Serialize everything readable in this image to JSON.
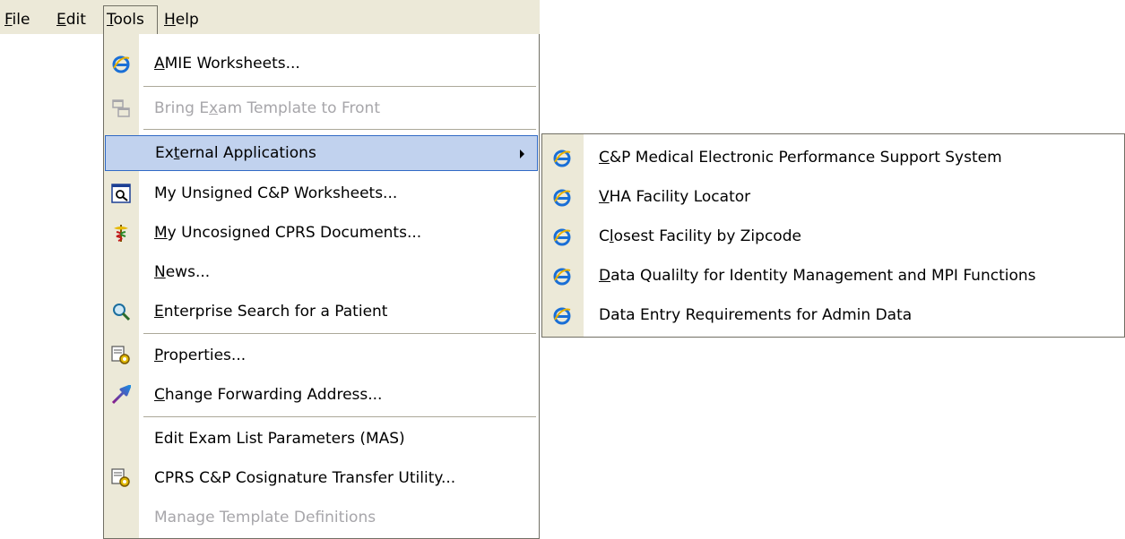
{
  "menubar": {
    "items": [
      {
        "pre": "",
        "ul": "F",
        "post": "ile"
      },
      {
        "pre": "",
        "ul": "E",
        "post": "dit"
      },
      {
        "pre": "",
        "ul": "T",
        "post": "ools"
      },
      {
        "pre": "",
        "ul": "H",
        "post": "elp"
      }
    ]
  },
  "tools_menu": {
    "items": [
      {
        "pre": "",
        "ul": "A",
        "post": "MIE Worksheets...",
        "icon": "ie-icon",
        "state": "enabled"
      },
      {
        "pre": "Bring E",
        "ul": "x",
        "post": "am Template to Front",
        "icon": "window-tile-icon",
        "state": "disabled"
      },
      {
        "pre": "Ex",
        "ul": "t",
        "post": "ernal Applications",
        "icon": "",
        "state": "highlighted",
        "submenu_arrow": "▶"
      },
      {
        "pre": "My Unsigned C&P Worksheets...",
        "ul": "",
        "post": "",
        "icon": "document-search-icon",
        "state": "enabled"
      },
      {
        "pre": "",
        "ul": "M",
        "post": "y Uncosigned CPRS Documents...",
        "icon": "caduceus-icon",
        "state": "enabled"
      },
      {
        "pre": "",
        "ul": "N",
        "post": "ews...",
        "icon": "",
        "state": "enabled"
      },
      {
        "pre": "",
        "ul": "E",
        "post": "nterprise Search for a Patient",
        "icon": "magnifier-icon",
        "state": "enabled"
      },
      {
        "pre": "",
        "ul": "P",
        "post": "roperties...",
        "icon": "properties-gear-icon",
        "state": "enabled"
      },
      {
        "pre": "",
        "ul": "C",
        "post": "hange Forwarding Address...",
        "icon": "forward-arrow-icon",
        "state": "enabled"
      },
      {
        "pre": "Edit Exam List Parameters (MAS)",
        "ul": "",
        "post": "",
        "icon": "",
        "state": "enabled"
      },
      {
        "pre": "CPRS C&P Cosignature Transfer Utility...",
        "ul": "",
        "post": "",
        "icon": "properties-gear-icon",
        "state": "enabled"
      },
      {
        "pre": "Manage Template Definitions",
        "ul": "",
        "post": "",
        "icon": "",
        "state": "disabled"
      }
    ]
  },
  "external_apps_submenu": {
    "items": [
      {
        "pre": "",
        "ul": "C",
        "post": "&P Medical Electronic Performance Support System",
        "icon": "ie-icon"
      },
      {
        "pre": "",
        "ul": "V",
        "post": "HA Facility Locator",
        "icon": "ie-icon"
      },
      {
        "pre": "C",
        "ul": "l",
        "post": "osest Facility by Zipcode",
        "icon": "ie-icon"
      },
      {
        "pre": "",
        "ul": "D",
        "post": "ata Qualilty for Identity Management and MPI Functions",
        "icon": "ie-icon"
      },
      {
        "pre": "Data Entry Requirements for Admin Data",
        "ul": "",
        "post": "",
        "icon": "ie-icon"
      }
    ]
  },
  "colors": {
    "menubar_bg": "#ece9d8",
    "highlight_bg": "#c1d2ee",
    "highlight_border": "#316ac5",
    "disabled_text": "#a7a6aa"
  }
}
